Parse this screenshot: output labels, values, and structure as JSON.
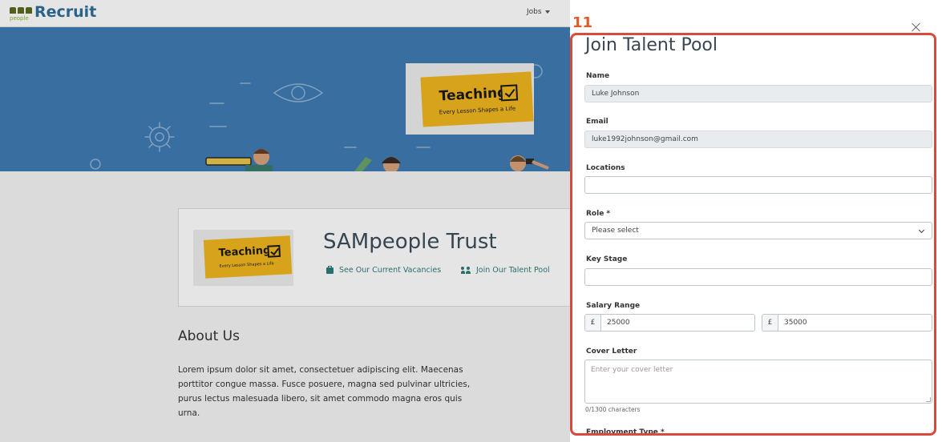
{
  "header": {
    "logo_sub": "people",
    "logo_text": "Recruit",
    "nav_jobs": "Jobs"
  },
  "banner": {
    "word": "Teaching",
    "tagline": "Every Lesson Shapes a Life"
  },
  "profile": {
    "org_name": "SAMpeople Trust",
    "link_vacancies": "See Our Current Vacancies",
    "link_talent_pool": "Join Our Talent Pool"
  },
  "about": {
    "title": "About Us",
    "body": "Lorem ipsum dolor sit amet, consectetuer adipiscing elit. Maecenas porttitor congue massa. Fusce posuere, magna sed pulvinar ultricies, purus lectus malesuada libero, sit amet commodo magna eros quis urna."
  },
  "drawer": {
    "step_number": "11",
    "title": "Join Talent Pool",
    "fields": {
      "name": {
        "label": "Name",
        "value": "Luke Johnson"
      },
      "email": {
        "label": "Email",
        "value": "luke1992johnson@gmail.com"
      },
      "locations": {
        "label": "Locations",
        "value": ""
      },
      "role": {
        "label": "Role *",
        "value": "Please select"
      },
      "key_stage": {
        "label": "Key Stage",
        "value": ""
      },
      "salary": {
        "label": "Salary Range",
        "currency": "£",
        "min": "25000",
        "max": "35000"
      },
      "cover_letter": {
        "label": "Cover Letter",
        "placeholder": "Enter your cover letter",
        "char_count": "0/1300 characters"
      },
      "employment_type": {
        "label": "Employment Type *"
      }
    }
  },
  "colors": {
    "accent_teal": "#2e7d7a",
    "highlight_red": "#d94a3e",
    "hero_blue": "#3f7bb3",
    "banner_yellow": "#f0b61e"
  }
}
